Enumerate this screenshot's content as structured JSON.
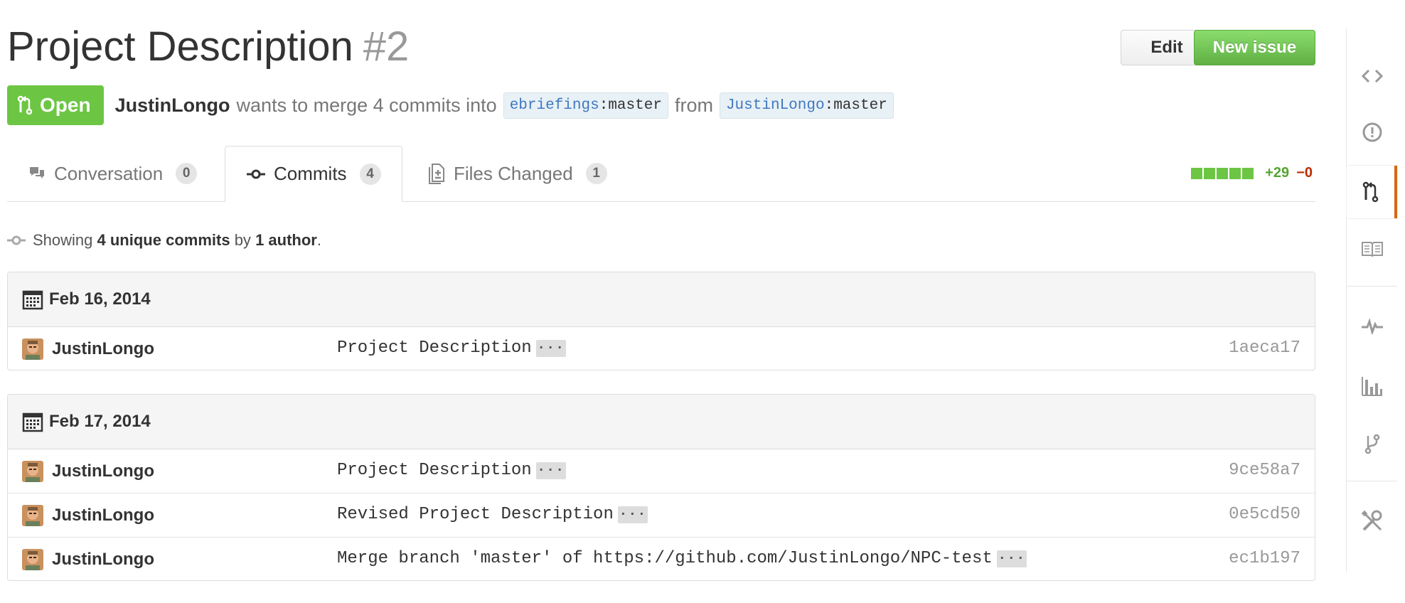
{
  "header": {
    "title": "Project Description",
    "number": "#2",
    "edit_label": "Edit",
    "new_issue_label": "New issue"
  },
  "meta": {
    "state": "Open",
    "author": "JustinLongo",
    "action_text": "wants to merge 4 commits into",
    "base_owner": "ebriefings",
    "base_branch": "master",
    "from_text": "from",
    "head_owner": "JustinLongo",
    "head_branch": "master",
    "sep": ":"
  },
  "tabs": [
    {
      "label": "Conversation",
      "count": "0"
    },
    {
      "label": "Commits",
      "count": "4"
    },
    {
      "label": "Files Changed",
      "count": "1"
    }
  ],
  "diffstat": {
    "additions": "+29",
    "deletions": "−0",
    "blocks": 5
  },
  "summary": {
    "prefix": "Showing",
    "commits": "4 unique commits",
    "by": "by",
    "authors": "1 author",
    "suffix": "."
  },
  "commit_groups": [
    {
      "date": "Feb 16, 2014",
      "commits": [
        {
          "author": "JustinLongo",
          "message": "Project Description",
          "sha": "1aeca17"
        }
      ]
    },
    {
      "date": "Feb 17, 2014",
      "commits": [
        {
          "author": "JustinLongo",
          "message": "Project Description",
          "sha": "9ce58a7"
        },
        {
          "author": "JustinLongo",
          "message": "Revised Project Description",
          "sha": "0e5cd50"
        },
        {
          "author": "JustinLongo",
          "message": "Merge branch 'master' of https://github.com/JustinLongo/NPC-test",
          "sha": "ec1b197"
        }
      ]
    }
  ],
  "ellipsis": "···",
  "sidebar": {
    "items": [
      "code-icon",
      "issues-icon",
      "pull-request-icon",
      "wiki-icon",
      "pulse-icon",
      "graphs-icon",
      "network-icon",
      "settings-icon"
    ],
    "selected": "pull-request-icon",
    "accent": "#d26911"
  },
  "colors": {
    "open_green": "#6cc644",
    "link_blue": "#4078c0",
    "deletion_red": "#bd2c00"
  }
}
